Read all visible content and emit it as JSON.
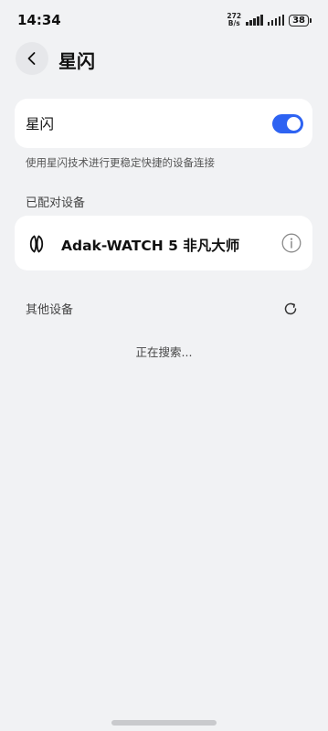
{
  "status_bar": {
    "time": "14:34",
    "net_speed_value": "272",
    "net_speed_unit": "B/s",
    "battery": "38"
  },
  "header": {
    "title": "星闪"
  },
  "starflash": {
    "label": "星闪",
    "enabled": true,
    "description": "使用星闪技术进行更稳定快捷的设备连接"
  },
  "paired": {
    "section_title": "已配对设备",
    "devices": [
      {
        "name": "Adak-WATCH 5 非凡大师"
      }
    ]
  },
  "other": {
    "section_title": "其他设备",
    "status": "正在搜索..."
  },
  "colors": {
    "accent": "#2e63f2",
    "background": "#f1f2f4",
    "card": "#ffffff"
  }
}
